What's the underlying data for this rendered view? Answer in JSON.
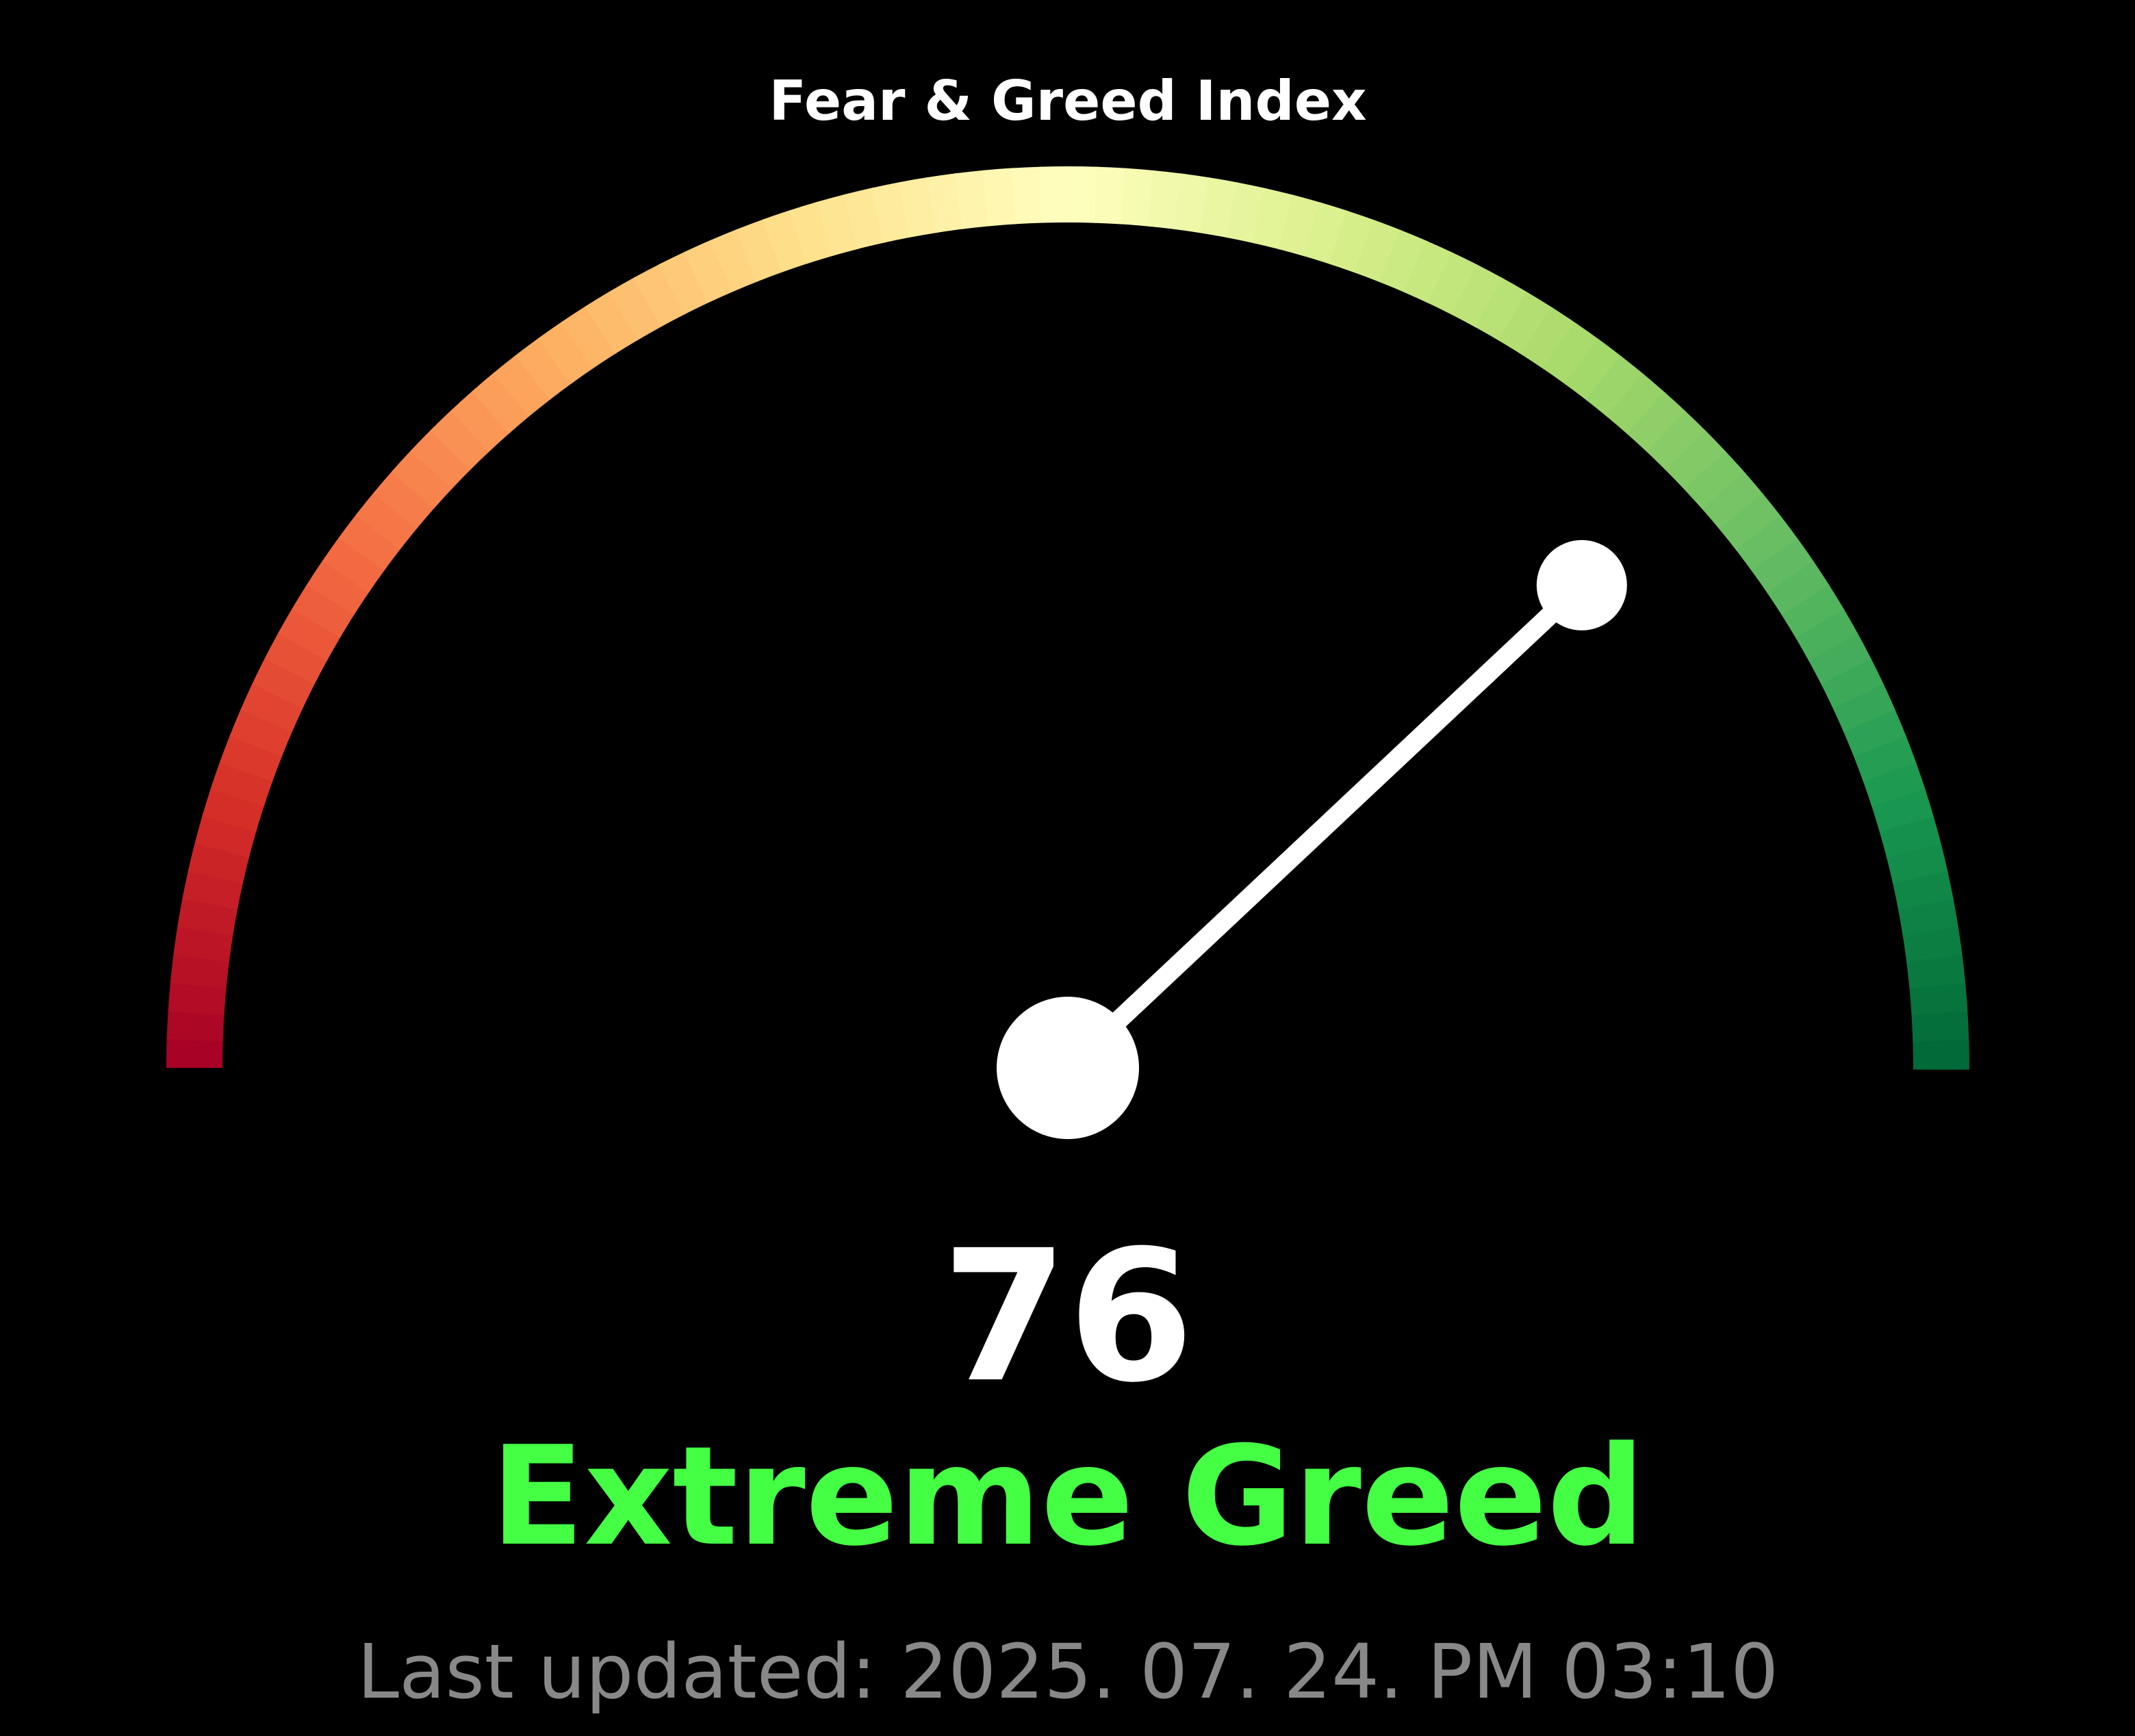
{
  "chart_data": {
    "type": "gauge",
    "title": "Fear & Greed Index",
    "value": 76,
    "value_label": "76",
    "min": 0,
    "max": 100,
    "sentiment": "Extreme Greed",
    "colormap": [
      "#a50026",
      "#d73027",
      "#f46d43",
      "#fdae61",
      "#fee08b",
      "#ffffbf",
      "#d9ef8b",
      "#a6d96a",
      "#66bd63",
      "#1a9850",
      "#006837"
    ]
  },
  "sentiment_color": "#44ff44",
  "last_updated": "Last updated: 2025. 07. 24. PM 03:10"
}
